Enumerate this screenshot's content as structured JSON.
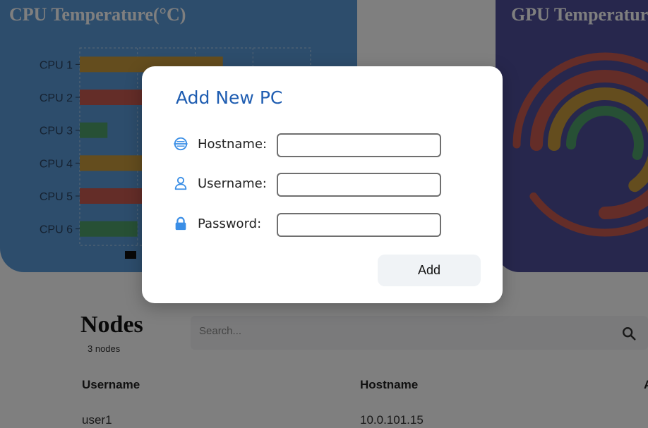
{
  "cpu_card": {
    "title": "CPU Temperature(°C)",
    "color": "#5b9bd8"
  },
  "gpu_card": {
    "title": "GPU Temperature",
    "color": "#4e4f9a"
  },
  "chart_data": [
    {
      "type": "bar",
      "orientation": "horizontal",
      "categories": [
        "CPU 1",
        "CPU 2",
        "CPU 3",
        "CPU 4",
        "CPU 5",
        "CPU 6"
      ],
      "values": [
        62,
        48,
        12,
        46,
        44,
        25
      ],
      "bar_colors": [
        "#c89b3c",
        "#c85a50",
        "#4fa06a",
        "#c89b3c",
        "#c85a50",
        "#4fa06a"
      ],
      "xlim": [
        0,
        100
      ],
      "grid": true
    },
    {
      "type": "radial-bar",
      "values": [
        90,
        75,
        65,
        55
      ],
      "ring_colors": [
        "#c85a50",
        "#c85a50",
        "#c89b3c",
        "#4fa06a"
      ]
    }
  ],
  "nodes": {
    "title": "Nodes",
    "count_label": "3 nodes",
    "search_placeholder": "Search...",
    "columns": [
      "Username",
      "Hostname",
      "A"
    ],
    "rows": [
      {
        "username": "user1",
        "hostname": "10.0.101.15"
      }
    ]
  },
  "modal": {
    "title": "Add New PC",
    "hostname_label": "Hostname:",
    "username_label": "Username:",
    "password_label": "Password:",
    "hostname_value": "",
    "username_value": "",
    "password_value": "",
    "add_label": "Add",
    "accent": "#1f5db1",
    "icon_color": "#3a8ee6"
  }
}
